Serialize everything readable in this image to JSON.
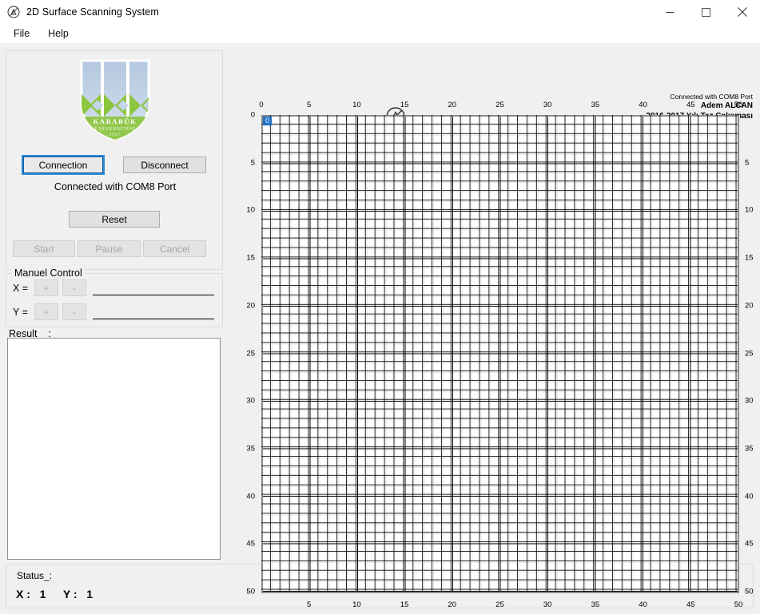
{
  "window": {
    "title": "2D Surface Scanning System",
    "icon": "app-logo-icon",
    "controls": {
      "minimize": "minimize-icon",
      "maximize": "maximize-icon",
      "close": "close-icon"
    }
  },
  "menu": {
    "items": [
      {
        "label": "File"
      },
      {
        "label": "Help"
      }
    ]
  },
  "connection_panel": {
    "logo_alt": "Karabuk Universitesi",
    "logo_text_line1": "KARABÜK",
    "logo_text_line2": "ÜNİVERSİTESİ",
    "logo_text_line3": "2007",
    "connect_button": "Connection",
    "disconnect_button": "Disconnect",
    "status_text": "Connected with COM8 Port",
    "reset_button": "Reset",
    "start_button": "Start",
    "pause_button": "Pause",
    "cancel_button": "Cancel"
  },
  "manuel_control": {
    "legend": "Manuel Control",
    "x_label": "X  =",
    "y_label": "Y  =",
    "plus": "+",
    "minus": "-",
    "x_value": "",
    "y_value": "",
    "x_placeholder": "",
    "y_placeholder": ""
  },
  "result": {
    "legend": "Result__:",
    "value": ""
  },
  "status_bar": {
    "label": "Status_:",
    "x_label": "X :",
    "x_value": "1",
    "y_label": "Y :",
    "y_value": "1"
  },
  "footer": {
    "center_icon": "no-entry-triangle-icon",
    "connection": "Connected with COM8 Port",
    "author": "Adem ALCAN",
    "thesis": "2016-2017 Yılı Tez Çalışması"
  },
  "colors": {
    "accent_blue": "#1f6fc4",
    "focus_blue": "#2e8ad6",
    "window_bg": "#f0f0f0",
    "grid_line": "#000000",
    "axis_line": "#8a8a8a",
    "logo_green": "#8cc63f",
    "logo_blue": "#b8cde4"
  },
  "chart_data": {
    "type": "heatmap",
    "title": "",
    "xlabel": "",
    "ylabel": "",
    "grid": true,
    "cells_x": 50,
    "cells_y": 50,
    "xlim": [
      0,
      50
    ],
    "ylim": [
      0,
      50
    ],
    "tick_step": 5,
    "x_ticks_top": [
      0,
      5,
      10,
      15,
      20,
      25,
      30,
      35,
      40,
      45,
      50
    ],
    "x_ticks_bottom": [
      5,
      10,
      15,
      20,
      25,
      30,
      35,
      40,
      45,
      50
    ],
    "y_ticks_left": [
      0,
      5,
      10,
      15,
      20,
      25,
      30,
      35,
      40,
      45,
      50
    ],
    "y_ticks_right": [
      5,
      10,
      15,
      20,
      25,
      30,
      35,
      40,
      45,
      50
    ],
    "selected_cell": {
      "x": 0,
      "y": 0,
      "label": "0"
    },
    "values": []
  }
}
